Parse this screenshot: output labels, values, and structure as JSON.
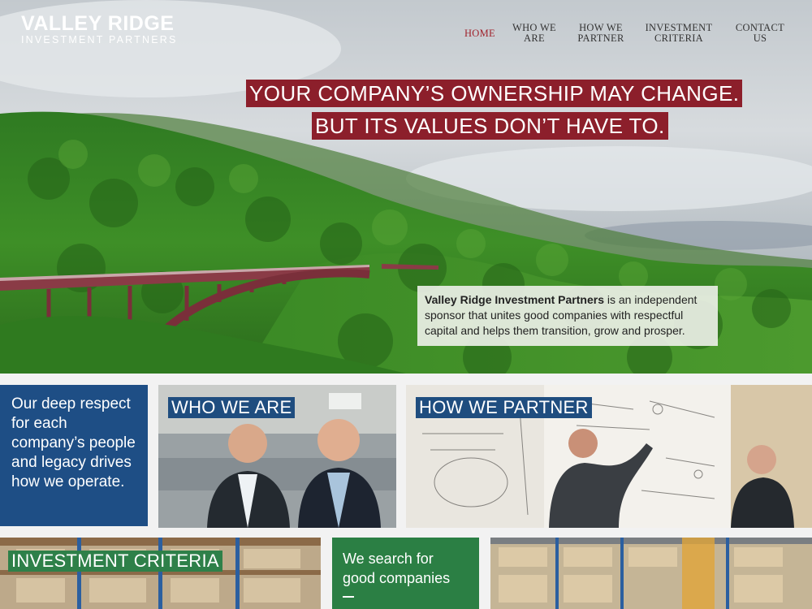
{
  "site": {
    "logo_main": "VALLEY RIDGE",
    "logo_sub": "INVESTMENT PARTNERS"
  },
  "nav": {
    "items": [
      {
        "line1": "HOME",
        "line2": ""
      },
      {
        "line1": "WHO WE",
        "line2": "ARE"
      },
      {
        "line1": "HOW WE",
        "line2": "PARTNER"
      },
      {
        "line1": "INVESTMENT",
        "line2": "CRITERIA"
      },
      {
        "line1": "CONTACT",
        "line2": "US"
      }
    ],
    "active": "HOME"
  },
  "hero": {
    "headline_line1": "YOUR COMPANY’S OWNERSHIP MAY CHANGE.",
    "headline_line2": "BUT ITS VALUES DON’T HAVE TO.",
    "intro_bold": "Valley Ridge Investment Partners",
    "intro_text": " is an independent sponsor that unites good companies with respectful capital and helps them transition, grow and prosper."
  },
  "tiles": {
    "respect_text": "Our deep respect for each company’s people and legacy drives how we operate.",
    "who_label": "WHO WE ARE",
    "how_label": "HOW WE PARTNER",
    "criteria_label": "INVESTMENT CRITERIA",
    "search_text": "We search for good companies"
  },
  "colors": {
    "accent_red": "#8c1f2b",
    "nav_active": "#a0232d",
    "brand_blue": "#1e4e85",
    "brand_green": "#2b7f44"
  }
}
